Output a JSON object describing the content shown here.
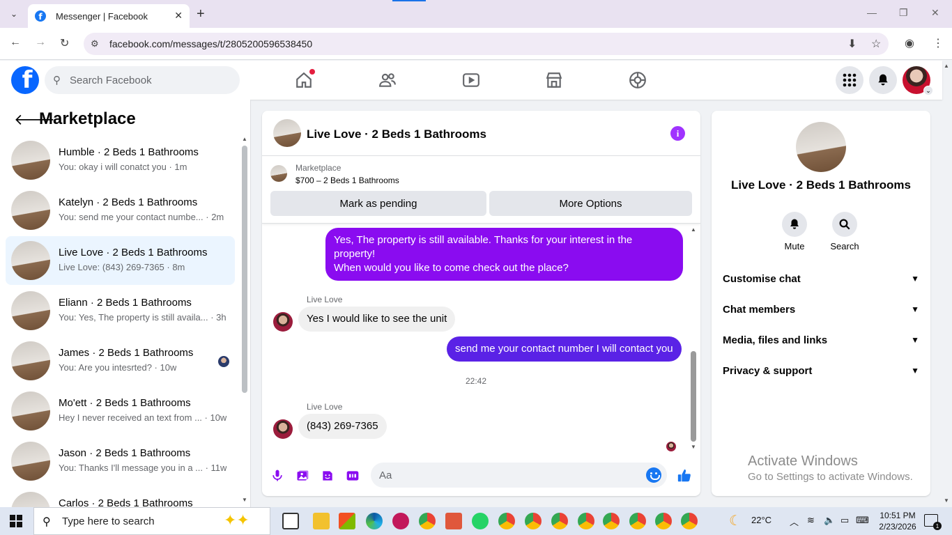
{
  "browser": {
    "tab_title": "Messenger | Facebook",
    "url": "facebook.com/messages/t/2805200596538450"
  },
  "fb": {
    "search_placeholder": "Search Facebook"
  },
  "sidebar": {
    "title": "Marketplace",
    "conversations": [
      {
        "name": "Humble · 2 Beds 1 Bathrooms",
        "preview": "You: okay i will conatct you · 1m",
        "active": false
      },
      {
        "name": "Katelyn · 2 Beds 1 Bathrooms",
        "preview": "You: send me your contact numbe... · 2m",
        "active": false
      },
      {
        "name": "Live Love · 2 Beds 1 Bathrooms",
        "preview": "Live Love: (843) 269-7365 · 8m",
        "active": true
      },
      {
        "name": "Eliann · 2 Beds 1 Bathrooms",
        "preview": "You: Yes, The property is still availa... · 3h",
        "active": false
      },
      {
        "name": "James · 2 Beds 1 Bathrooms",
        "preview": "You: Are you intesrted? · 10w",
        "active": false
      },
      {
        "name": "Mo'ett · 2 Beds 1 Bathrooms",
        "preview": "Hey I never received an text from ... · 10w",
        "active": false
      },
      {
        "name": "Jason · 2 Beds 1 Bathrooms",
        "preview": "You: Thanks I'll message you in a ... · 11w",
        "active": false
      },
      {
        "name": "Carlos · 2 Beds 1 Bathrooms",
        "preview": "",
        "active": false
      }
    ]
  },
  "chat": {
    "title": "Live Love · 2 Beds 1 Bathrooms",
    "marketplace_label": "Marketplace",
    "listing": "$700 – 2 Beds 1 Bathrooms",
    "mark_pending": "Mark as pending",
    "more_options": "More Options",
    "messages": {
      "out1_line1": "Yes, The property is still available. Thanks for your interest in the property!",
      "out1_line2": "When would you like to come check out the place?",
      "sender": "Live Love",
      "in1": "Yes I would like to see the unit",
      "out2": "send me your contact number I will contact you",
      "time": "22:42",
      "in2": "(843) 269-7365"
    },
    "composer_placeholder": "Aa"
  },
  "info_panel": {
    "name": "Live Love · 2 Beds 1 Bathrooms",
    "mute": "Mute",
    "search": "Search",
    "rows": [
      "Customise chat",
      "Chat members",
      "Media, files and links",
      "Privacy & support"
    ],
    "activate_title": "Activate Windows",
    "activate_sub": "Go to Settings to activate Windows."
  },
  "taskbar": {
    "search_text": "Type here to search",
    "weather": "22°C",
    "time": "10:51 PM",
    "date": "2/23/2026",
    "notifications": "1"
  },
  "colors": {
    "fb_blue": "#0866ff",
    "bubble_purple": "#8a0cf0",
    "bubble_indigo": "#5a22e6",
    "active_row": "#ebf5ff"
  }
}
